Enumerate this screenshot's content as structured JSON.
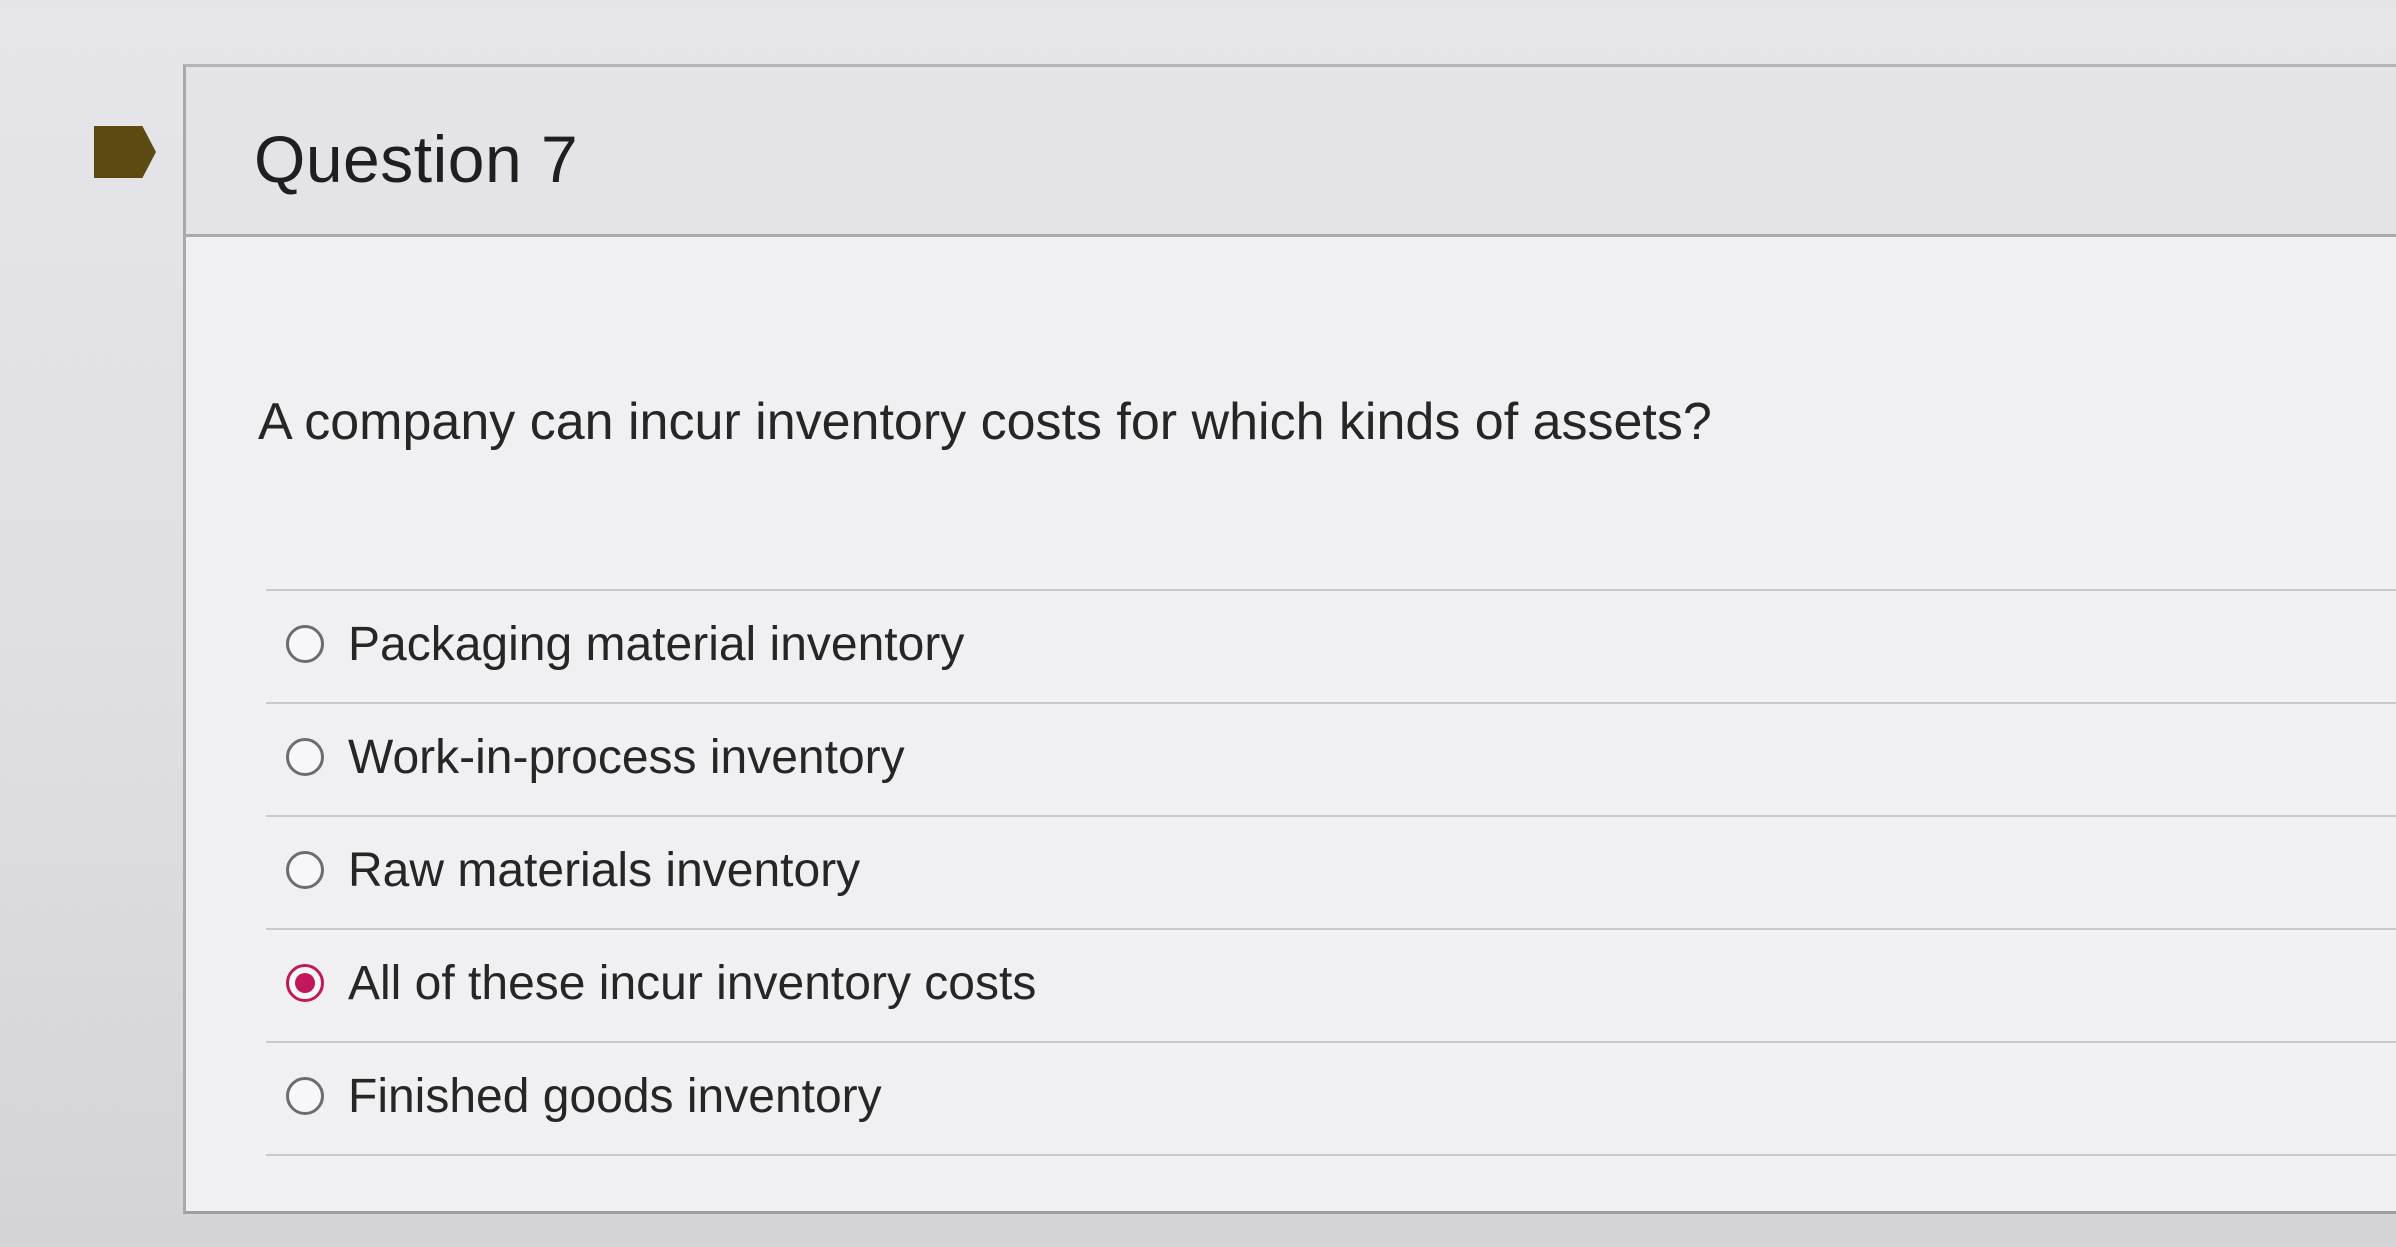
{
  "question": {
    "title": "Question 7",
    "text": "A company can incur inventory costs for which kinds of assets?",
    "flag_icon": "bookmark-flag-icon",
    "flag_color": "#5c4a12",
    "selected_color": "#c2185b",
    "options": [
      {
        "label": "Packaging material inventory",
        "selected": false
      },
      {
        "label": "Work-in-process inventory",
        "selected": false
      },
      {
        "label": "Raw materials inventory",
        "selected": false
      },
      {
        "label": "All of these incur inventory costs",
        "selected": true
      },
      {
        "label": "Finished goods inventory",
        "selected": false
      }
    ]
  }
}
